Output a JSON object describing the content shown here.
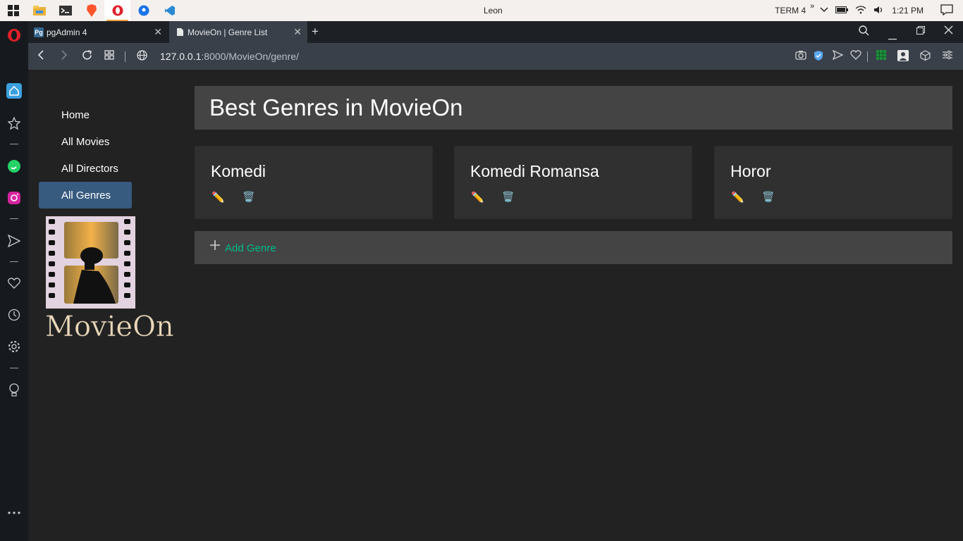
{
  "taskbar": {
    "window_title": "Leon",
    "tray": {
      "term": "TERM 4",
      "chevron": "»",
      "time": "1:21 PM"
    },
    "apps": [
      "windows-start-icon",
      "file-explorer-icon",
      "terminal-icon",
      "brave-icon",
      "opera-icon",
      "maps-icon",
      "vscode-icon"
    ]
  },
  "browser": {
    "tabs": [
      {
        "label": "pgAdmin 4",
        "favicon": "Pg"
      },
      {
        "label": "MovieOn | Genre List",
        "favicon": "doc"
      }
    ],
    "address": {
      "host": "127.0.0.1",
      "path": ":8000/MovieOn/genre/"
    }
  },
  "sidebar": {
    "items": [
      {
        "label": "Home"
      },
      {
        "label": "All Movies"
      },
      {
        "label": "All Directors"
      },
      {
        "label": "All Genres"
      }
    ],
    "logo_text": "MovieOn"
  },
  "main": {
    "title": "Best Genres in MovieOn",
    "genres": [
      {
        "name": "Komedi"
      },
      {
        "name": "Komedi Romansa"
      },
      {
        "name": "Horor"
      }
    ],
    "add_label": "Add Genre"
  },
  "colors": {
    "accent": "#375a7f",
    "success": "#00bc8c",
    "card_bg": "#303030",
    "header_bg": "#444444"
  }
}
